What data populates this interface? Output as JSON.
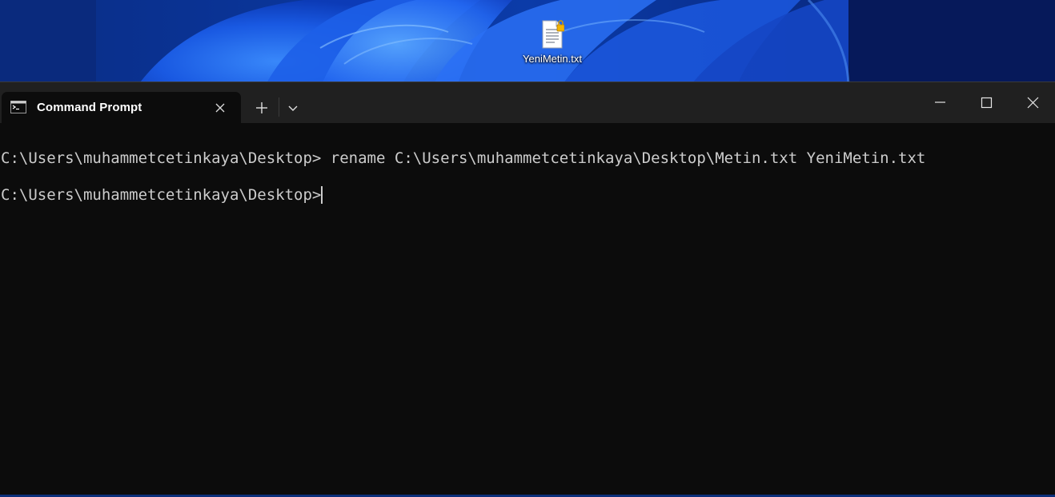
{
  "desktop": {
    "icons": [
      {
        "label": "YeniMetin.txt",
        "icon": "text-file-locked-icon"
      }
    ]
  },
  "terminal": {
    "tab": {
      "title": "Command Prompt",
      "icon": "cmd-icon"
    },
    "controls": {
      "new_tab": "plus-icon",
      "dropdown": "chevron-down-icon",
      "minimize": "minimize-icon",
      "maximize": "maximize-icon",
      "close": "close-icon"
    },
    "lines": [
      "C:\\Users\\muhammetcetinkaya\\Desktop> rename C:\\Users\\muhammetcetinkaya\\Desktop\\Metin.txt YeniMetin.txt",
      "C:\\Users\\muhammetcetinkaya\\Desktop>"
    ],
    "colors": {
      "background": "#0c0c0c",
      "titlebar": "#202020",
      "text": "#cccccc"
    }
  }
}
